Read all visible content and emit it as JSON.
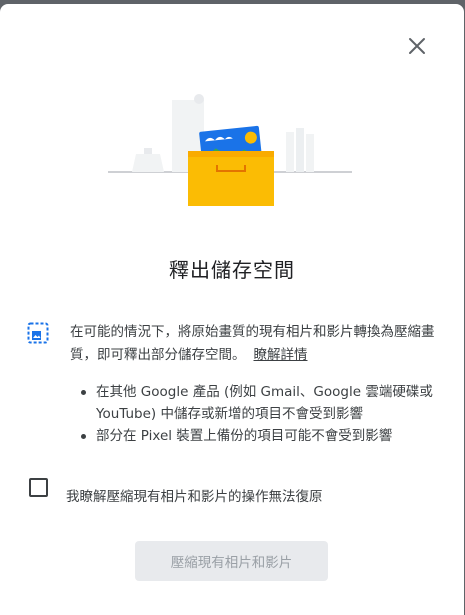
{
  "dialog": {
    "close_icon": "close-icon",
    "title": "釋出儲存空間",
    "description": "在可能的情況下，將原始畫質的現有相片和影片轉換為壓縮畫質，即可釋出部分儲存空間。",
    "learn_more_link": "瞭解詳情",
    "bullets": [
      "在其他 Google 產品 (例如 Gmail、Google 雲端硬碟或 YouTube) 中儲存或新增的項目不會受到影響",
      "部分在 Pixel 裝置上備份的項目可能不會受到影響"
    ],
    "checkbox_label": "我瞭解壓縮現有相片和影片的操作無法復原",
    "checkbox_checked": false,
    "action_button": "壓縮現有相片和影片",
    "action_button_enabled": false
  },
  "colors": {
    "accent_blue": "#1a73e8",
    "box_yellow": "#fbbc04",
    "disabled_button_bg": "#e8eaed",
    "disabled_button_text": "#9aa0a6"
  }
}
